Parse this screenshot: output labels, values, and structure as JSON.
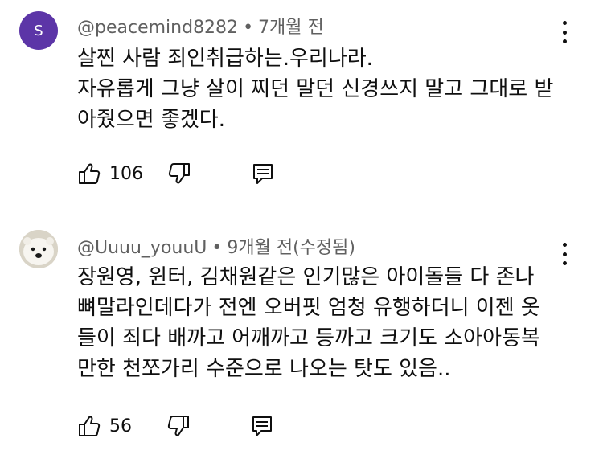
{
  "comments": [
    {
      "avatar_letter": "S",
      "avatar_color": "#5c35a7",
      "handle": "@peacemind8282",
      "separator": "•",
      "time": "7개월 전",
      "text": "살찐 사람 죄인취급하는.우리나라.\n자유롭게 그냥 살이 찌던 말던 신경쓰지 말고 그대로 받아줬으면 좋겠다.",
      "like_count": "106"
    },
    {
      "avatar_icon": "polar-bear-avatar",
      "handle": "@Uuuu_youuU",
      "separator": "•",
      "time": "9개월 전(수정됨)",
      "text": "장원영, 윈터, 김채원같은 인기많은 아이돌들 다 존나 뼈말라인데다가 전엔 오버핏 엄청 유행하더니 이젠 옷들이 죄다 배까고 어깨까고 등까고 크기도 소아아동복만한 천쪼가리 수준으로 나오는 탓도 있음..",
      "like_count": "56"
    }
  ]
}
